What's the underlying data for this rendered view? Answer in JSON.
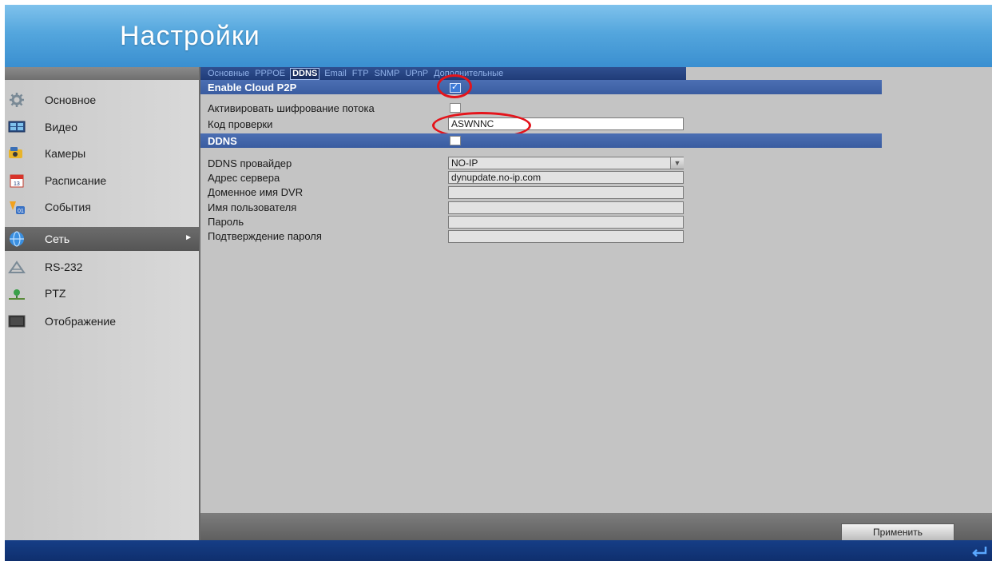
{
  "header": {
    "title": "Настройки"
  },
  "sidebar": {
    "items": [
      {
        "label": "Основное",
        "icon": "gear-icon"
      },
      {
        "label": "Видео",
        "icon": "video-icon"
      },
      {
        "label": "Камеры",
        "icon": "camera-icon"
      },
      {
        "label": "Расписание",
        "icon": "calendar-icon"
      },
      {
        "label": "События",
        "icon": "events-icon"
      },
      {
        "label": "Сеть",
        "icon": "network-icon",
        "active": true
      },
      {
        "label": "RS-232",
        "icon": "serial-icon"
      },
      {
        "label": "PTZ",
        "icon": "ptz-icon"
      },
      {
        "label": "Отображение",
        "icon": "display-icon"
      }
    ]
  },
  "tabs": [
    {
      "label": "Основные"
    },
    {
      "label": "PPPOE"
    },
    {
      "label": "DDNS",
      "active": true
    },
    {
      "label": "Email"
    },
    {
      "label": "FTP"
    },
    {
      "label": "SNMP"
    },
    {
      "label": "UPnP"
    },
    {
      "label": "Дополнительные"
    }
  ],
  "cloud": {
    "enable_label": "Enable Cloud P2P",
    "enable_checked": true,
    "encrypt_label": "Активировать шифрование потока",
    "encrypt_checked": false,
    "code_label": "Код проверки",
    "code_value": "ASWNNC"
  },
  "ddns": {
    "section_label": "DDNS",
    "enabled": false,
    "provider_label": "DDNS провайдер",
    "provider_value": "NO-IP",
    "server_label": "Адрес сервера",
    "server_value": "dynupdate.no-ip.com",
    "domain_label": "Доменное имя DVR",
    "domain_value": "",
    "user_label": "Имя пользователя",
    "user_value": "",
    "password_label": "Пароль",
    "password_value": "",
    "confirm_label": "Подтверждение пароля",
    "confirm_value": ""
  },
  "footer": {
    "apply_label": "Применить"
  },
  "colors": {
    "header": "#54a6dd",
    "section_bar": "#4c6fb3",
    "highlight": "#e4141b"
  }
}
